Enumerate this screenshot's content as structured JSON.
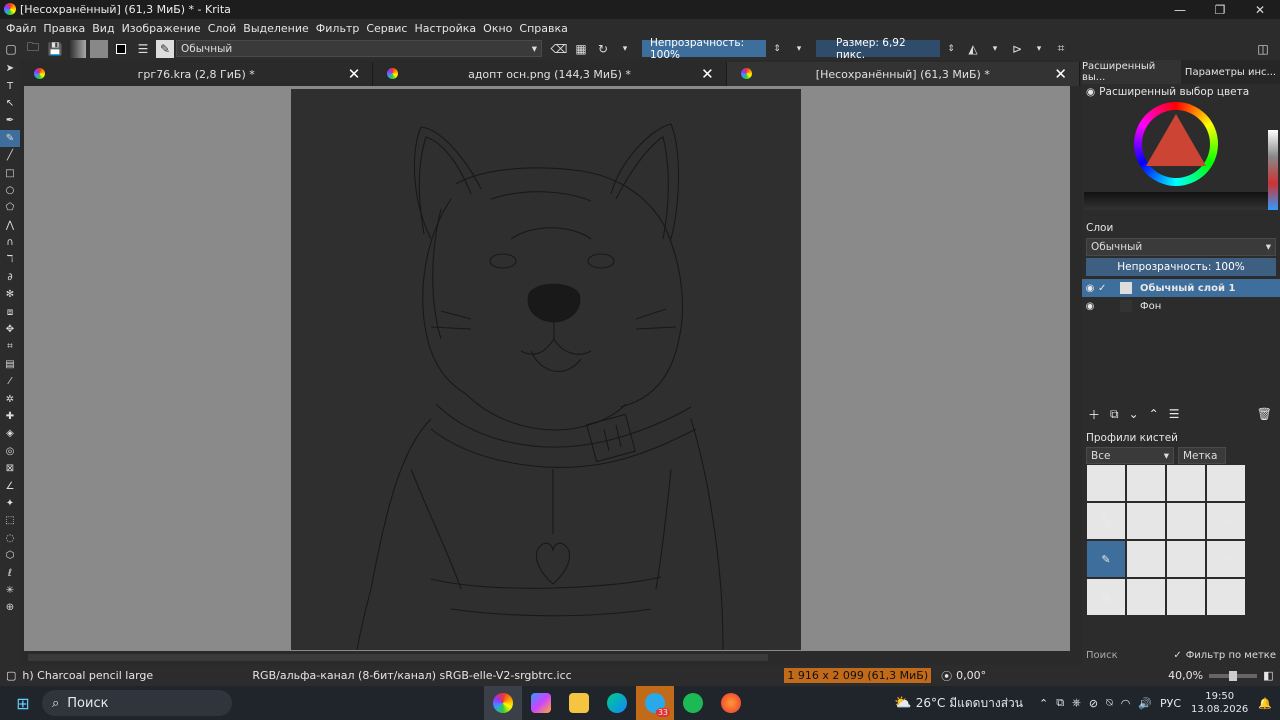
{
  "window": {
    "title": "[Несохранённый]  (61,3 МиБ) * - Krita",
    "controls": [
      "—",
      "❐",
      "✕"
    ]
  },
  "menu": [
    "Файл",
    "Правка",
    "Вид",
    "Изображение",
    "Слой",
    "Выделение",
    "Фильтр",
    "Сервис",
    "Настройка",
    "Окно",
    "Справка"
  ],
  "toolbar": {
    "blend_mode": "Обычный",
    "opacity": "Непрозрачность: 100%",
    "size": "Размер: 6,92 пикс."
  },
  "tabs": [
    {
      "label": "грг76.kra (2,8 ГиБ) *"
    },
    {
      "label": "адопт осн.png (144,3 МиБ) *"
    },
    {
      "label": "[Несохранённый]  (61,3 МиБ) *"
    }
  ],
  "docker": {
    "tabs": [
      "Расширенный вы...",
      "Параметры инс..."
    ],
    "color_title": "Расширенный выбор цвета",
    "layers_title": "Слои",
    "layer_blend": "Обычный",
    "layer_opacity": "Непрозрачность:  100%",
    "layers": [
      {
        "name": "Обычный слой 1",
        "active": true
      },
      {
        "name": "Фон",
        "active": false
      }
    ],
    "brush_title": "Профили кистей",
    "brush_filter": "Все",
    "brush_tag": "Метка",
    "search_placeholder": "Поиск",
    "filter_by_tag": "Фильтр по метке"
  },
  "status": {
    "brush": "h) Charcoal pencil large",
    "color_space": "RGB/альфа-канал (8-бит/канал)  sRGB-elle-V2-srgbtrc.icc",
    "dimensions": "1 916 x 2 099 (61,3 МиБ)",
    "rotation": "0,00°",
    "zoom": "40,0%"
  },
  "taskbar": {
    "search": "Поиск",
    "weather": "26°C  มีแดดบางส่วน",
    "lang": "РУС",
    "time": "19:50",
    "date": "13.08.2026",
    "telegram_badge": "33"
  }
}
